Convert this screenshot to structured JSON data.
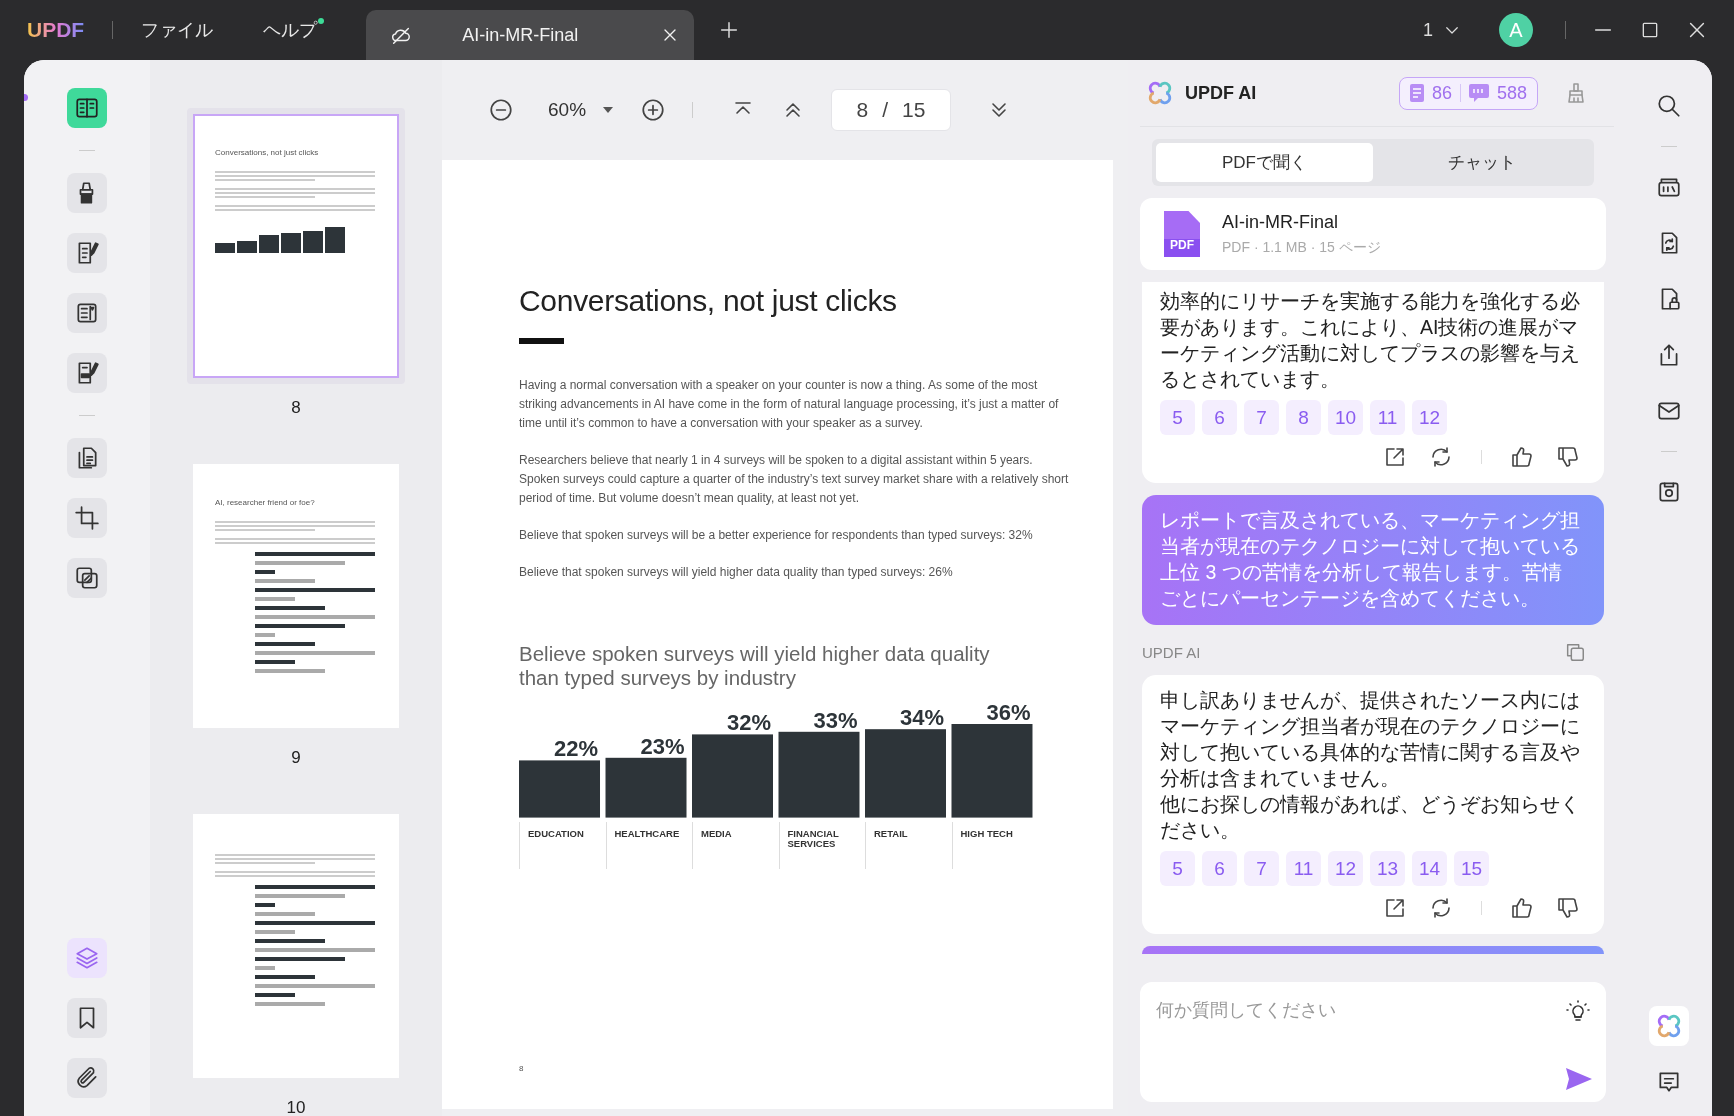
{
  "titlebar": {
    "logo": "UPDF",
    "menus": [
      {
        "label": "ファイル",
        "badge": false
      },
      {
        "label": "ヘルプ",
        "badge": true
      }
    ],
    "tab": {
      "title": "AI-in-MR-Final"
    },
    "page_selector": "1",
    "avatar": "A"
  },
  "tool_groups": [
    [
      {
        "kind": "reader",
        "selected": true
      }
    ],
    [
      {
        "kind": "highlight",
        "selected": false
      },
      {
        "kind": "edit",
        "selected": false
      },
      {
        "kind": "form",
        "selected": false
      },
      {
        "kind": "redact",
        "selected": false
      }
    ],
    [
      {
        "kind": "organize",
        "selected": false
      },
      {
        "kind": "crop",
        "selected": false
      },
      {
        "kind": "overlay",
        "selected": false
      }
    ]
  ],
  "bottom_tools": [
    {
      "kind": "layers",
      "selected": true
    },
    {
      "kind": "bookmark",
      "selected": false
    },
    {
      "kind": "attach",
      "selected": false
    }
  ],
  "thumbnails": [
    {
      "page": "8",
      "title": "Conversations, not just clicks",
      "selected": true
    },
    {
      "page": "9",
      "title": "AI, researcher friend or foe?",
      "selected": false
    },
    {
      "page": "10",
      "selected": false
    }
  ],
  "toolbar": {
    "zoom": "60%",
    "page": "8",
    "separator": "/",
    "total": "15"
  },
  "page": {
    "heading": "Conversations, not just clicks",
    "paragraphs": [
      "Having a normal conversation with a speaker on your counter is now a thing. As some of the most striking advancements in AI have come in the form of natural language processing, it’s just a matter of time until it’s common to have a conversation with your speaker as a survey.",
      "Researchers believe that nearly 1 in 4 surveys will be spoken to a digital assistant within 5 years. Spoken surveys could capture a quarter of the industry’s text survey market share with a relatively short period of time. But volume doesn’t mean quality, at least not yet.",
      "Believe that spoken surveys will be a better experience for respondents than typed surveys: 32%",
      "Believe that spoken surveys will yield higher data quality than typed surveys: 26%"
    ],
    "chart_data": {
      "type": "bar",
      "title": "Believe spoken surveys will yield higher data quality than typed surveys by industry",
      "categories": [
        "EDUCATION",
        "HEALTHCARE",
        "MEDIA",
        "FINANCIAL SERVICES",
        "RETAIL",
        "HIGH TECH"
      ],
      "values": [
        22,
        23,
        32,
        33,
        34,
        36
      ],
      "value_labels": [
        "22%",
        "23%",
        "32%",
        "33%",
        "34%",
        "36%"
      ],
      "data_labels": true
    },
    "page_number": "8"
  },
  "ai": {
    "title": "UPDF AI",
    "quota": {
      "pages": "86",
      "messages": "588"
    },
    "tabs": [
      {
        "label": "PDFで聞く",
        "selected": true
      },
      {
        "label": "チャット",
        "selected": false
      }
    ],
    "file": {
      "badge": "PDF",
      "name": "AI-in-MR-Final",
      "meta": "PDF · 1.1 MB · 15 ページ"
    },
    "messages": [
      {
        "kind": "answer",
        "paragraphs": [
          "効率的にリサーチを実施する能力を強化する必要があります。これにより、AI技術の進展がマーケティング活動に対してプラスの影響を与えるとされています。"
        ],
        "refs": [
          "5",
          "6",
          "7",
          "8",
          "10",
          "11",
          "12"
        ]
      },
      {
        "kind": "question",
        "text": "レポートで言及されている、マーケティング担当者が現在のテクノロジーに対して抱いている上位 3 つの苦情を分析して報告します。苦情ごとにパーセンテージを含めてください。"
      },
      {
        "kind": "answer",
        "sender": "UPDF AI",
        "paragraphs": [
          "申し訳ありませんが、提供されたソース内にはマーケティング担当者が現在のテクノロジーに対して抱いている具体的な苦情に関する言及や分析は含まれていません。",
          "他にお探しの情報があれば、どうぞお知らせください。"
        ],
        "refs": [
          "5",
          "6",
          "7",
          "11",
          "12",
          "13",
          "14",
          "15"
        ]
      },
      {
        "kind": "question"
      }
    ],
    "input": {
      "placeholder": "何か質問してください"
    }
  },
  "right_tool_groups": [
    [
      {
        "kind": "search"
      }
    ],
    [
      {
        "kind": "ocr"
      },
      {
        "kind": "convert"
      },
      {
        "kind": "protect"
      },
      {
        "kind": "share"
      },
      {
        "kind": "email"
      }
    ],
    [
      {
        "kind": "save"
      }
    ]
  ],
  "right_bottom_tools": [
    {
      "kind": "ai"
    },
    {
      "kind": "comment"
    }
  ]
}
